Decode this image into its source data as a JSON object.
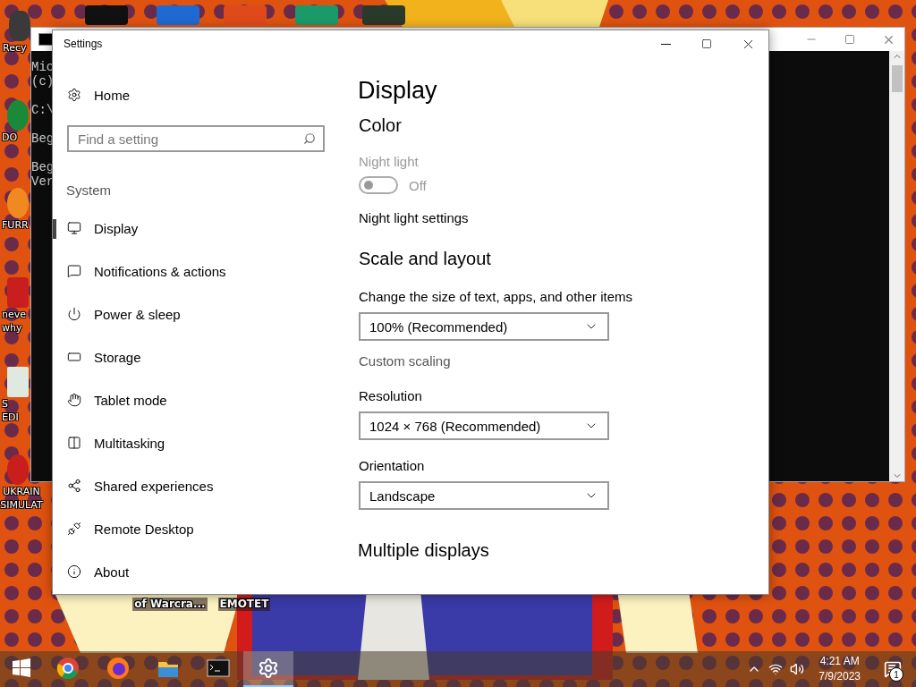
{
  "desktop": {
    "icons": [
      {
        "lines": [
          "Recy"
        ]
      },
      {
        "lines": [
          "DO"
        ]
      },
      {
        "lines": [
          "FURR"
        ]
      },
      {
        "lines": [
          "neve",
          "why"
        ]
      },
      {
        "lines": [
          "S",
          "EDI"
        ]
      },
      {
        "lines": [
          "UKRAIN",
          "SIMULAT"
        ]
      },
      {
        "lines": [
          "of Warcra..."
        ]
      },
      {
        "lines": [
          "EMOTET"
        ]
      }
    ]
  },
  "console": {
    "lines": [
      "Mic",
      "(c)",
      "C:\\",
      "Beg",
      "Beg",
      "Ver"
    ]
  },
  "settings": {
    "title": "Settings",
    "sidebar": {
      "home": "Home",
      "search": {
        "placeholder": "Find a setting"
      },
      "section": "System",
      "items": [
        {
          "label": "Display",
          "selected": true
        },
        {
          "label": "Notifications & actions",
          "selected": false
        },
        {
          "label": "Power & sleep",
          "selected": false
        },
        {
          "label": "Storage",
          "selected": false
        },
        {
          "label": "Tablet mode",
          "selected": false
        },
        {
          "label": "Multitasking",
          "selected": false
        },
        {
          "label": "Shared experiences",
          "selected": false
        },
        {
          "label": "Remote Desktop",
          "selected": false
        },
        {
          "label": "About",
          "selected": false
        }
      ]
    },
    "content": {
      "title": "Display",
      "color_heading": "Color",
      "night_light": {
        "label": "Night light",
        "on": false,
        "disabled": true,
        "state_text": "Off"
      },
      "night_light_link": "Night light settings",
      "scale_heading": "Scale and layout",
      "scale": {
        "label": "Change the size of text, apps, and other items",
        "value": "100% (Recommended)"
      },
      "custom_scaling": "Custom scaling",
      "resolution": {
        "label": "Resolution",
        "value": "1024 × 768 (Recommended)"
      },
      "orientation": {
        "label": "Orientation",
        "value": "Landscape"
      },
      "multiple_heading": "Multiple displays"
    }
  },
  "taskbar": {
    "apps": [
      {
        "active": false
      },
      {
        "active": false
      },
      {
        "active": false
      },
      {
        "active": false
      },
      {
        "active": true
      }
    ],
    "time": "4:21 AM",
    "date": "7/9/2023",
    "notification_count": "1"
  }
}
